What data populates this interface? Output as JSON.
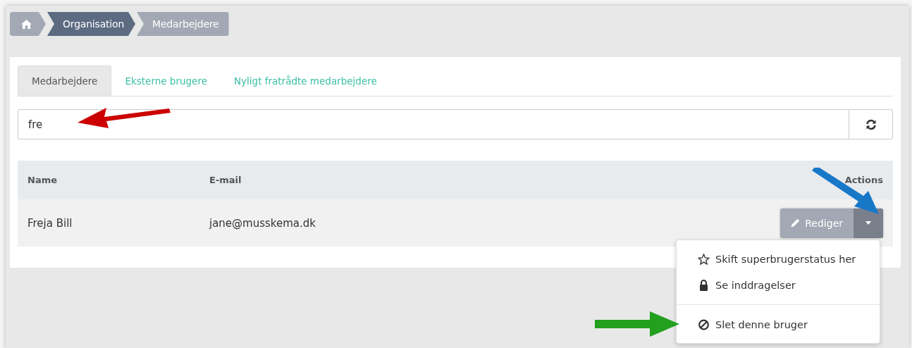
{
  "breadcrumb": [
    {
      "kind": "home",
      "selected": false
    },
    {
      "kind": "text",
      "label": "Organisation",
      "selected": true
    },
    {
      "kind": "text",
      "label": "Medarbejdere",
      "selected": false
    }
  ],
  "tabs": [
    {
      "label": "Medarbejdere",
      "selected": true
    },
    {
      "label": "Eksterne brugere",
      "selected": false
    },
    {
      "label": "Nyligt fratrådte medarbejdere",
      "selected": false
    }
  ],
  "search": {
    "value": "fre"
  },
  "table": {
    "columns": [
      "Name",
      "E-mail",
      "Actions"
    ],
    "rows": [
      {
        "name": "Freja Bill",
        "email": "jane@musskema.dk",
        "edit_button": "Rediger"
      }
    ]
  },
  "dropdown_menu": {
    "expanded": true,
    "items": [
      {
        "label": "Skift superbrugerstatus her",
        "divider_before": false
      },
      {
        "label": "Se inddragelser",
        "divider_before": false
      },
      {
        "label": "Slet denne bruger",
        "divider_before": true
      }
    ]
  }
}
